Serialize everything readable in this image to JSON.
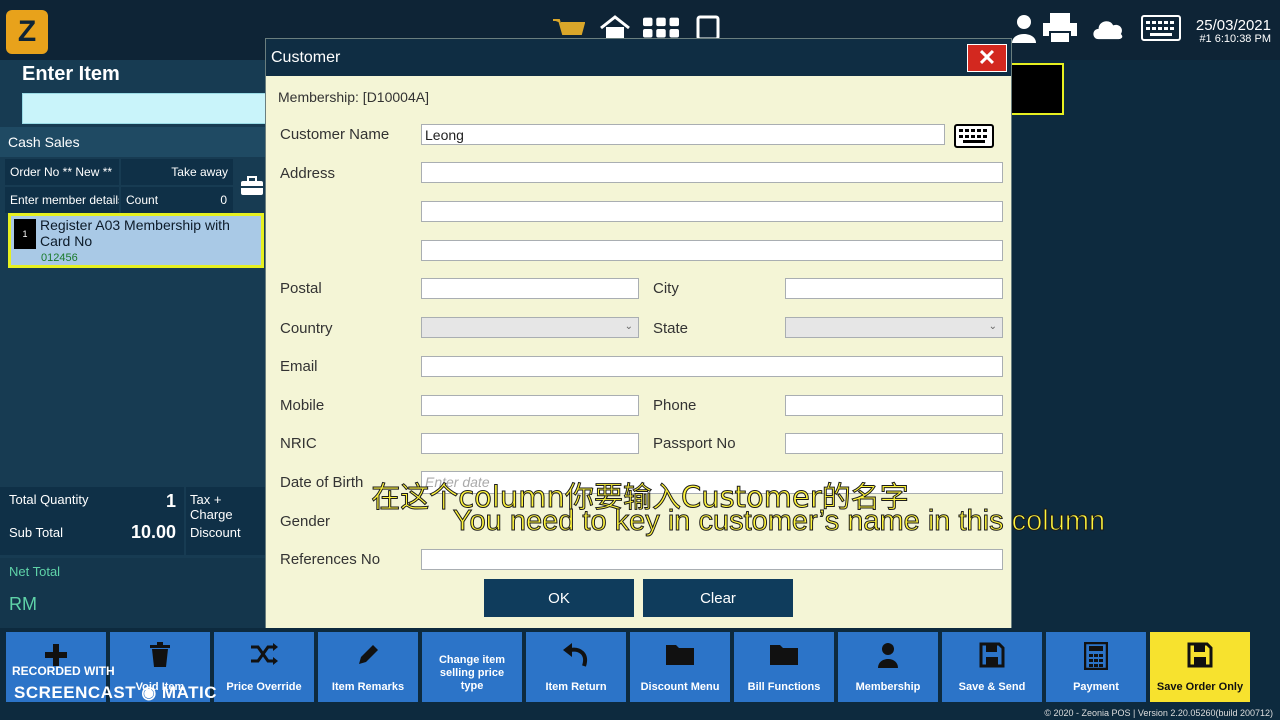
{
  "topbar": {
    "date": "25/03/2021",
    "station_time": "#1  6:10:38 PM"
  },
  "left": {
    "enter_title": "Enter Item",
    "cash_label": "Cash Sales",
    "order_no": "Order No  ** New **",
    "take_away": "Take away",
    "member_details": "Enter member details",
    "count_label": "Count",
    "count_value": "0",
    "item": {
      "number": "1",
      "name": "Register A03 Membership with Card No",
      "code": "012456"
    },
    "total_qty_label": "Total Quantity",
    "total_qty_value": "1",
    "tax_label": "Tax + Charge",
    "subtotal_label": "Sub Total",
    "subtotal_value": "10.00",
    "discount_label": "Discount",
    "net_label": "Net Total",
    "currency": "RM"
  },
  "dialog": {
    "title": "Customer",
    "membership": "Membership: [D10004A]",
    "labels": {
      "customer_name": "Customer Name",
      "address": "Address",
      "postal": "Postal",
      "city": "City",
      "country": "Country",
      "state": "State",
      "email": "Email",
      "mobile": "Mobile",
      "phone": "Phone",
      "nric": "NRIC",
      "passport": "Passport No",
      "dob": "Date of Birth",
      "gender": "Gender",
      "references": "References No"
    },
    "values": {
      "customer_name": "Leong"
    },
    "placeholders": {
      "dob": "Enter date"
    },
    "ok": "OK",
    "clear": "Clear"
  },
  "subtitles": {
    "chinese": "在这个column你要输入Customer的名字",
    "english": "You need to key in customer’s name in this column"
  },
  "toolbar": [
    {
      "label": "",
      "icon": "plus-icon"
    },
    {
      "label": "Void Item",
      "icon": "trash-icon"
    },
    {
      "label": "Price Override",
      "icon": "shuffle-icon"
    },
    {
      "label": "Item Remarks",
      "icon": "pencil-icon"
    },
    {
      "label": "Change item selling price type",
      "icon": "none"
    },
    {
      "label": "Item Return",
      "icon": "undo-icon"
    },
    {
      "label": "Discount Menu",
      "icon": "folder-icon"
    },
    {
      "label": "Bill Functions",
      "icon": "folder-icon"
    },
    {
      "label": "Membership",
      "icon": "user-icon"
    },
    {
      "label": "Save & Send",
      "icon": "save-icon"
    },
    {
      "label": "Payment",
      "icon": "calculator-icon"
    },
    {
      "label": "Save Order Only",
      "icon": "save-icon"
    }
  ],
  "watermark": {
    "line1": "RECORDED WITH",
    "line2": "SCREENCAST ◉ MATIC"
  },
  "footer": "© 2020 - Zeonia POS  |   Version 2.20.05260(build 200712)"
}
